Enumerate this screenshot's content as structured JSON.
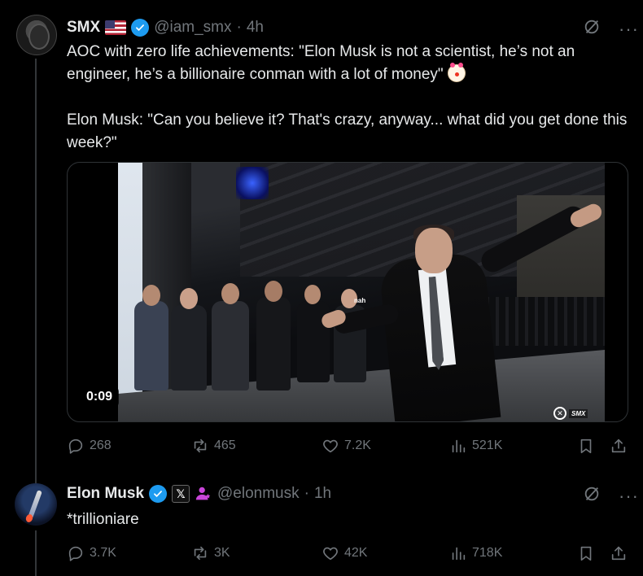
{
  "tweet1": {
    "name": "SMX",
    "flag_icon": "us-flag-icon",
    "handle": "@iam_smx",
    "separator": "·",
    "time": "4h",
    "text_line1": "AOC with zero life achievements: \"Elon Musk is not a scientist, he’s not an engineer, he’s a billionaire conman with a lot of money\"",
    "text_line2": "Elon Musk: \"Can you believe it? That's crazy, anyway... what did you get done this week?\"",
    "media": {
      "duration": "0:09",
      "overlay_caption": "nah",
      "watermark": "SMX"
    },
    "stats": {
      "replies": "268",
      "reposts": "465",
      "likes": "7.2K",
      "views": "521K"
    }
  },
  "tweet2": {
    "name": "Elon Musk",
    "x_badge": "𝕏",
    "handle": "@elonmusk",
    "separator": "·",
    "time": "1h",
    "text": "*trillioniare",
    "stats": {
      "replies": "3.7K",
      "reposts": "3K",
      "likes": "42K",
      "views": "718K"
    }
  },
  "colors": {
    "background": "#000000",
    "text": "#e7e9ea",
    "muted": "#71767b",
    "verified": "#1d9bf0",
    "affiliate": "#c945d9"
  }
}
